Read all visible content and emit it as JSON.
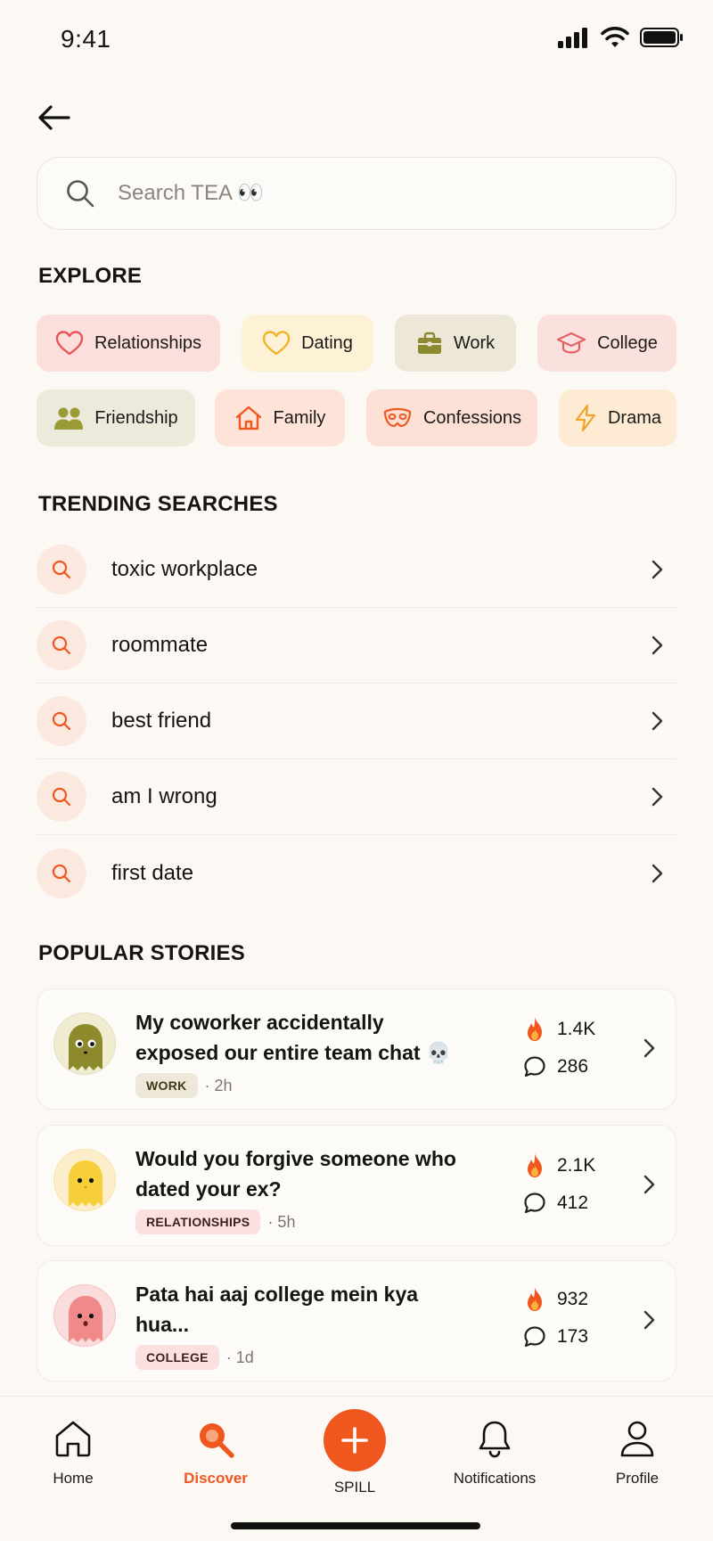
{
  "status_bar": {
    "time": "9:41"
  },
  "search": {
    "placeholder": "Search TEA 👀"
  },
  "explore": {
    "title": "EXPLORE",
    "categories": [
      {
        "label": "Relationships",
        "icon": "heart-icon",
        "bg": "#fbdfdd",
        "icon_color": "#e8545a"
      },
      {
        "label": "Dating",
        "icon": "heart-outline-icon",
        "bg": "#fdf1d6",
        "icon_color": "#f0b429"
      },
      {
        "label": "Work",
        "icon": "briefcase-icon",
        "bg": "#ece7d6",
        "icon_color": "#8b8a2e"
      },
      {
        "label": "College",
        "icon": "graduation-cap-icon",
        "bg": "#fbe1de",
        "icon_color": "#e36268"
      },
      {
        "label": "Friendship",
        "icon": "people-icon",
        "bg": "#ecebdb",
        "icon_color": "#9a9a37"
      },
      {
        "label": "Family",
        "icon": "house-icon",
        "bg": "#fde3d8",
        "icon_color": "#f0571f"
      },
      {
        "label": "Confessions",
        "icon": "mask-icon",
        "bg": "#fde0d5",
        "icon_color": "#f0571f"
      },
      {
        "label": "Drama",
        "icon": "lightning-icon",
        "bg": "#fdecd3",
        "icon_color": "#f0a429"
      }
    ]
  },
  "trending": {
    "title": "TRENDING SEARCHES",
    "items": [
      "toxic workplace",
      "roommate",
      "best friend",
      "am I wrong",
      "first date"
    ]
  },
  "popular": {
    "title": "POPULAR STORIES",
    "stories": [
      {
        "title": "My coworker accidentally exposed our entire team chat 💀",
        "tag": "WORK",
        "age": "· 2h",
        "likes": "1.4K",
        "comments": "286",
        "tag_bg": "#ede8d7",
        "tag_color": "#3d3a16",
        "avatar_bg": "#f0ecd2",
        "ghost_color": "#8c8a2b"
      },
      {
        "title": "Would you forgive someone who dated your ex?",
        "tag": "RELATIONSHIPS",
        "age": "· 5h",
        "likes": "2.1K",
        "comments": "412",
        "tag_bg": "#fbe0df",
        "tag_color": "#3d1e1c",
        "avatar_bg": "#fdeecb",
        "ghost_color": "#f7cf3b"
      },
      {
        "title": "Pata hai aaj college mein kya hua...",
        "tag": "COLLEGE",
        "age": "· 1d",
        "likes": "932",
        "comments": "173",
        "tag_bg": "#fbe0df",
        "tag_color": "#3d1e1c",
        "avatar_bg": "#fbdcdc",
        "ghost_color": "#f08a8a"
      }
    ]
  },
  "nav": {
    "items": [
      {
        "label": "Home",
        "icon": "home-icon"
      },
      {
        "label": "Discover",
        "icon": "discover-icon"
      },
      {
        "label": "SPILL",
        "icon": "plus-icon"
      },
      {
        "label": "Notifications",
        "icon": "bell-icon"
      },
      {
        "label": "Profile",
        "icon": "person-icon"
      }
    ],
    "active": "Discover"
  },
  "colors": {
    "accent": "#f0571f",
    "background": "#fcf9f5"
  }
}
